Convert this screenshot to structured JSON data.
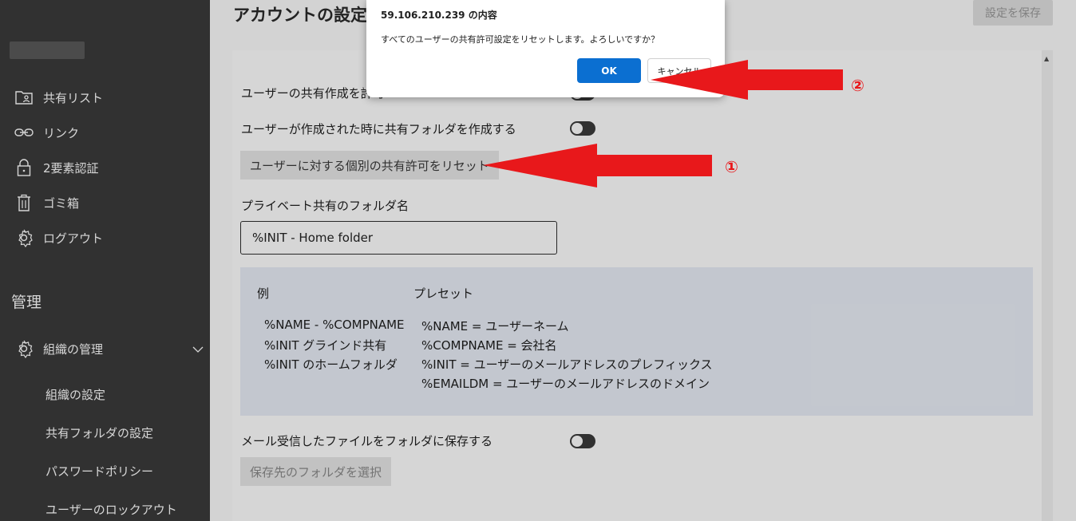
{
  "sidebar": {
    "items": [
      {
        "label": "共有リスト",
        "icon": "folder-person-icon"
      },
      {
        "label": "リンク",
        "icon": "link-icon"
      },
      {
        "label": "2要素認証",
        "icon": "lock-icon"
      },
      {
        "label": "ゴミ箱",
        "icon": "trash-icon"
      },
      {
        "label": "ログアウト",
        "icon": "gear-icon"
      }
    ],
    "admin_heading": "管理",
    "org_menu": {
      "label": "組織の管理",
      "icon": "gear-icon",
      "expand_icon": "chevron-down-icon"
    },
    "sub_items": [
      "組織の設定",
      "共有フォルダの設定",
      "パスワードポリシー",
      "ユーザーのロックアウト"
    ]
  },
  "header": {
    "title": "アカウントの設定",
    "save_label": "設定を保存"
  },
  "settings": {
    "allow_share_label": "ユーザーの共有作成を許可",
    "create_folder_label": "ユーザーが作成された時に共有フォルダを作成する",
    "reset_button": "ユーザーに対する個別の共有許可をリセット",
    "private_folder_label": "プライベート共有のフォルダ名",
    "private_folder_value": "%INIT - Home folder",
    "save_mail_label": "メール受信したファイルをフォルダに保存する",
    "select_folder_button": "保存先のフォルダを選択",
    "toggles": {
      "allow_share": false,
      "create_folder": false,
      "save_mail": false
    }
  },
  "examples": {
    "example_heading": "例",
    "preset_heading": "プレセット",
    "example_lines": [
      "%NAME - %COMPNAME",
      "%INIT グラインド共有",
      "%INIT のホームフォルダ"
    ],
    "preset_lines": [
      "%NAME = ユーザーネーム",
      "%COMPNAME = 会社名",
      "%INIT = ユーザーのメールアドレスのプレフィックス",
      "%EMAILDM = ユーザーのメールアドレスのドメイン"
    ]
  },
  "dialog": {
    "title": "59.106.210.239 の内容",
    "message": "すべてのユーザーの共有許可設定をリセットします。よろしいですか？",
    "ok_label": "OK",
    "cancel_label": "キャンセル"
  },
  "annotations": {
    "marker_1": "①",
    "marker_2": "②",
    "arrow_color": "#e8181b"
  },
  "colors": {
    "sidebar_bg": "#3b3b3b",
    "accent_blue": "#0b6fd1",
    "example_box_bg": "#e9eef7"
  }
}
